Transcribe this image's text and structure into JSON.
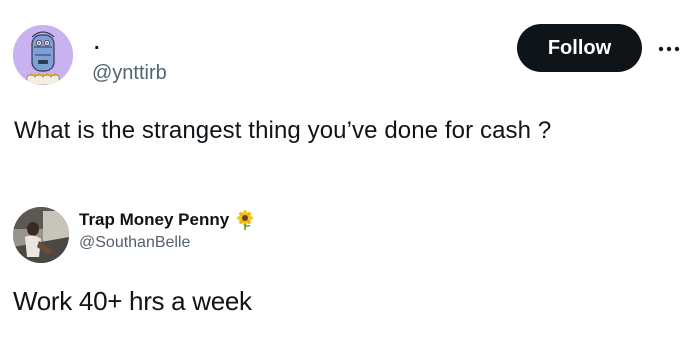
{
  "tweet": {
    "author": {
      "display_name": ".",
      "handle": "@ynttirb",
      "avatar_icon": "robot-avatar",
      "avatar_bg": "#c9b2f0"
    },
    "follow_label": "Follow",
    "more_icon": "more-horizontal-icon",
    "text": "What is the strangest thing you’ve done for cash ?"
  },
  "reply": {
    "author": {
      "display_name": "Trap Money Penny",
      "badge_icon": "sunflower-emoji",
      "handle": "@SouthanBelle",
      "avatar_icon": "photo-avatar"
    },
    "text": "Work 40+ hrs a week"
  },
  "colors": {
    "text": "#0f1419",
    "muted": "#536471",
    "button_bg": "#0f1419",
    "button_text": "#ffffff"
  }
}
